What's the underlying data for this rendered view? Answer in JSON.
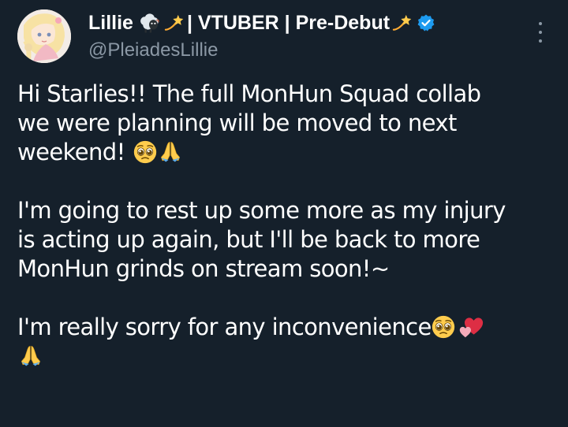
{
  "author": {
    "name": "Lillie",
    "name_suffix": "| VTUBER | Pre-Debut",
    "handle": "@PleiadesLillie",
    "verified": true
  },
  "icons": [
    "sheep-emoji-icon",
    "dizzy-emoji-icon",
    "verified-badge-icon",
    "more-options-icon",
    "pleading-face-emoji-icon",
    "folded-hands-emoji-icon",
    "two-hearts-emoji-icon"
  ],
  "tweet": {
    "para1_line1": "Hi Starlies!! The full MonHun Squad collab",
    "para1_line2": "we were planning will be moved to next",
    "para1_line3": "weekend!",
    "para2_line1": "I'm going to rest up some more as my injury",
    "para2_line2": "is acting up again, but I'll be back to more",
    "para2_line3": "MonHun grinds on stream soon!~",
    "para3_line1": "I'm really sorry for any inconvenience"
  },
  "colors": {
    "background": "#15202b",
    "text": "#ffffff",
    "secondary_text": "#8b98a5",
    "verified_blue": "#1d9bf0"
  }
}
